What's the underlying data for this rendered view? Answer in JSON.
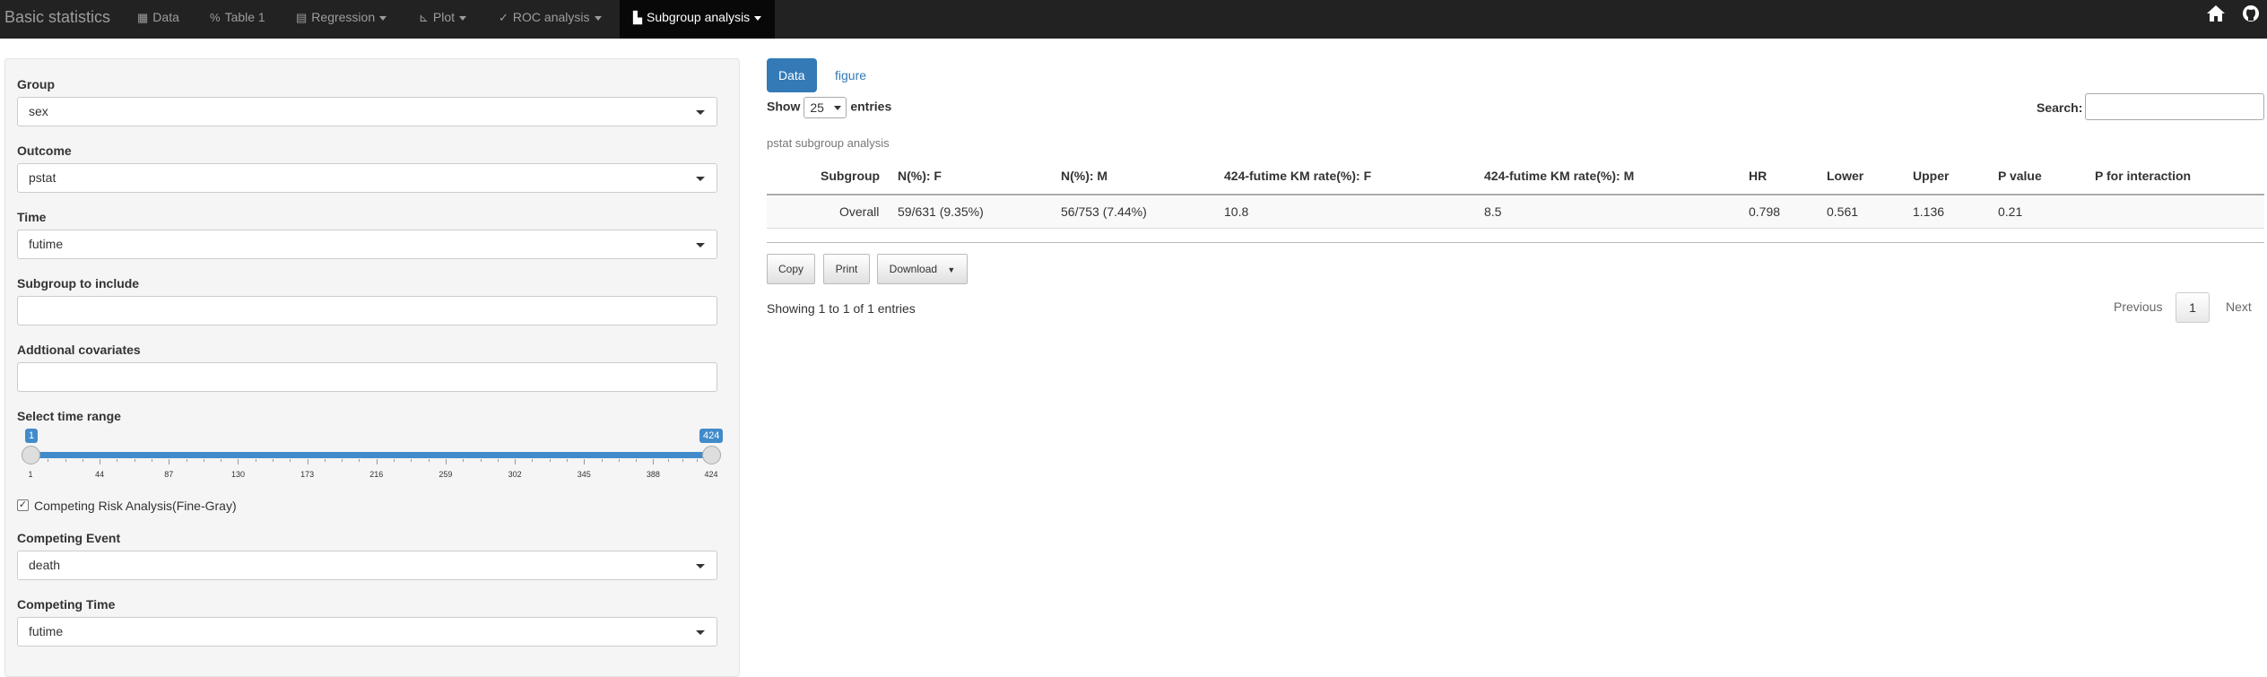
{
  "navbar": {
    "brand": "Basic statistics",
    "items": [
      {
        "label": "Data",
        "icon": "table-icon",
        "dropdown": false
      },
      {
        "label": "Table 1",
        "icon": "percent-icon",
        "dropdown": false
      },
      {
        "label": "Regression",
        "icon": "list-alt-icon",
        "dropdown": true
      },
      {
        "label": "Plot",
        "icon": "chart-icon",
        "dropdown": true
      },
      {
        "label": "ROC analysis",
        "icon": "check-icon",
        "dropdown": true
      },
      {
        "label": "Subgroup analysis",
        "icon": "bar-chart-icon",
        "dropdown": true,
        "active": true
      }
    ],
    "right_icons": [
      "home-icon",
      "github-icon"
    ]
  },
  "sidebar": {
    "group_label": "Group",
    "group_value": "sex",
    "outcome_label": "Outcome",
    "outcome_value": "pstat",
    "time_label": "Time",
    "time_value": "futime",
    "subgroup_label": "Subgroup to include",
    "subgroup_value": "",
    "covariates_label": "Addtional covariates",
    "covariates_value": "",
    "time_range_label": "Select time range",
    "slider": {
      "min": 1,
      "max": 424,
      "from": 1,
      "to": 424,
      "from_label": "1",
      "to_label": "424",
      "ticks": [
        "1",
        "44",
        "87",
        "130",
        "173",
        "216",
        "259",
        "302",
        "345",
        "388",
        "424"
      ]
    },
    "competing_checkbox_label": "Competing Risk Analysis(Fine-Gray)",
    "competing_checked": true,
    "competing_event_label": "Competing Event",
    "competing_event_value": "death",
    "competing_time_label": "Competing Time",
    "competing_time_value": "futime"
  },
  "main": {
    "tabs": [
      "Data",
      "figure"
    ],
    "show_label": "Show",
    "entries_value": "25",
    "entries_label": "entries",
    "search_label": "Search:",
    "caption": "pstat subgroup analysis",
    "table": {
      "headers": [
        "Subgroup",
        "N(%): F",
        "N(%): M",
        "424-futime KM rate(%): F",
        "424-futime KM rate(%): M",
        "HR",
        "Lower",
        "Upper",
        "P value",
        "P for interaction"
      ],
      "rows": [
        [
          "Overall",
          "59/631 (9.35%)",
          "56/753 (7.44%)",
          "10.8",
          "8.5",
          "0.798",
          "0.561",
          "1.136",
          "0.21",
          ""
        ]
      ]
    },
    "buttons": {
      "copy": "Copy",
      "print": "Print",
      "download": "Download"
    },
    "info": "Showing 1 to 1 of 1 entries",
    "pagination": {
      "previous": "Previous",
      "current": "1",
      "next": "Next"
    }
  },
  "colors": {
    "navbar": "#222222",
    "accent": "#337ab7",
    "slider": "#428bca"
  }
}
